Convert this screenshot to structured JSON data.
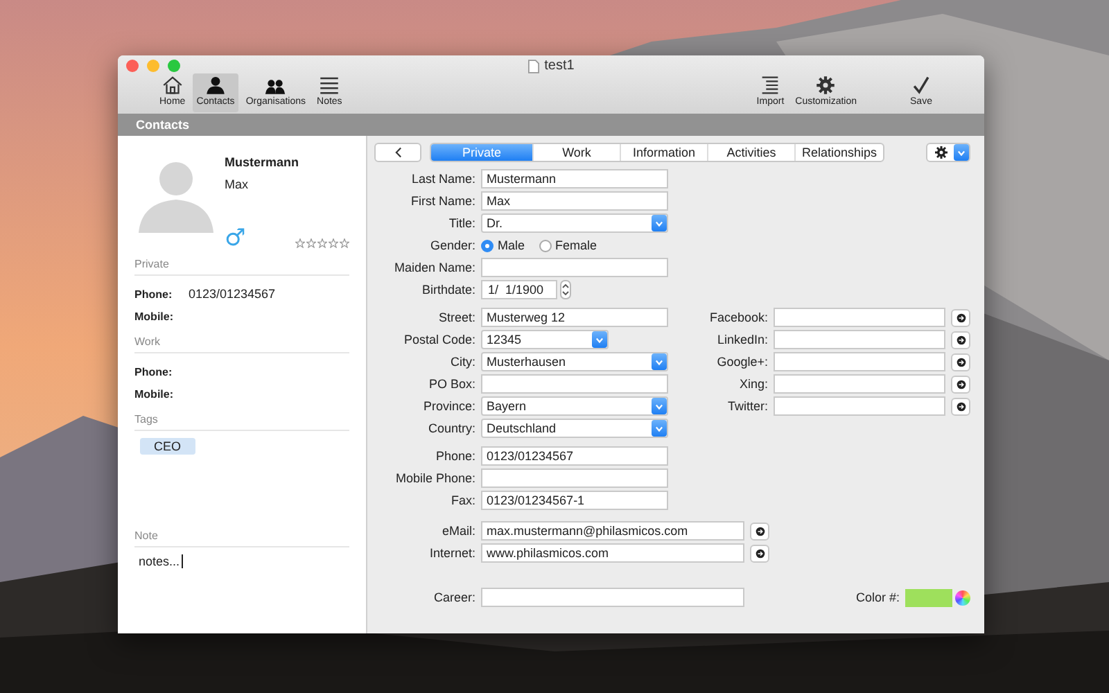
{
  "window": {
    "title": "test1"
  },
  "toolbar": {
    "left": [
      {
        "label": "Home",
        "selected": false
      },
      {
        "label": "Contacts",
        "selected": true
      },
      {
        "label": "Organisations",
        "selected": false
      },
      {
        "label": "Notes",
        "selected": false
      }
    ],
    "right": [
      {
        "label": "Import"
      },
      {
        "label": "Customization"
      },
      {
        "label": "Save"
      }
    ]
  },
  "section_bar": "Contacts",
  "card": {
    "last_name": "Mustermann",
    "first_name": "Max",
    "gender_symbol": "♂",
    "stars": 0,
    "sections": [
      {
        "heading": "Private",
        "fields": [
          {
            "label": "Phone:",
            "value": "0123/01234567"
          },
          {
            "label": "Mobile:"
          }
        ]
      },
      {
        "heading": "Work",
        "fields": [
          {
            "label": "Phone:"
          },
          {
            "label": "Mobile:"
          }
        ]
      }
    ],
    "tags_heading": "Tags",
    "tags": [
      "CEO"
    ],
    "note_heading": "Note",
    "note": "notes..."
  },
  "tabs": [
    {
      "label": "Private",
      "selected": true
    },
    {
      "label": "Work",
      "selected": false
    },
    {
      "label": "Information",
      "selected": false
    },
    {
      "label": "Activities",
      "selected": false
    },
    {
      "label": "Relationships",
      "selected": false
    }
  ],
  "groups": [
    {
      "fields": [
        {
          "label": "Last Name:",
          "kind": "text",
          "value": "Mustermann"
        },
        {
          "label": "First Name:",
          "kind": "text",
          "value": "Max"
        },
        {
          "label": "Title:",
          "kind": "select",
          "value": "Dr."
        },
        {
          "label": "Gender:",
          "kind": "radio",
          "options": [
            {
              "label": "Male",
              "selected": true
            },
            {
              "label": "Female",
              "selected": false
            }
          ]
        },
        {
          "label": "Maiden Name:",
          "kind": "text"
        },
        {
          "label": "Birthdate:",
          "kind": "date",
          "value": "1/  1/1900"
        }
      ]
    },
    {
      "fields": [
        {
          "label": "Street:",
          "kind": "text",
          "value": "Musterweg 12"
        },
        {
          "label": "Postal Code:",
          "kind": "select",
          "value": "12345"
        },
        {
          "label": "City:",
          "kind": "select",
          "value": "Musterhausen"
        },
        {
          "label": "PO Box:",
          "kind": "text"
        },
        {
          "label": "Province:",
          "kind": "select",
          "value": "Bayern"
        },
        {
          "label": "Country:",
          "kind": "select",
          "value": "Deutschland"
        }
      ],
      "side": [
        {
          "label": "Facebook:",
          "kind": "link"
        },
        {
          "label": "LinkedIn:",
          "kind": "link"
        },
        {
          "label": "Google+:",
          "kind": "link"
        },
        {
          "label": "Xing:",
          "kind": "link"
        },
        {
          "label": "Twitter:",
          "kind": "link"
        }
      ]
    },
    {
      "fields": [
        {
          "label": "Phone:",
          "kind": "text",
          "value": "0123/01234567"
        },
        {
          "label": "Mobile Phone:",
          "kind": "text"
        },
        {
          "label": "Fax:",
          "kind": "text",
          "value": "0123/01234567-1"
        }
      ]
    },
    {
      "fields": [
        {
          "label": "eMail:",
          "kind": "link",
          "value": "max.mustermann@philasmicos.com"
        },
        {
          "label": "Internet:",
          "kind": "link",
          "value": "www.philasmicos.com"
        }
      ]
    },
    {
      "fields": [
        {
          "label": "Career:",
          "kind": "text"
        }
      ],
      "side": [
        {
          "label": "Color #:",
          "kind": "color",
          "color": "#9ee05c"
        }
      ]
    }
  ]
}
